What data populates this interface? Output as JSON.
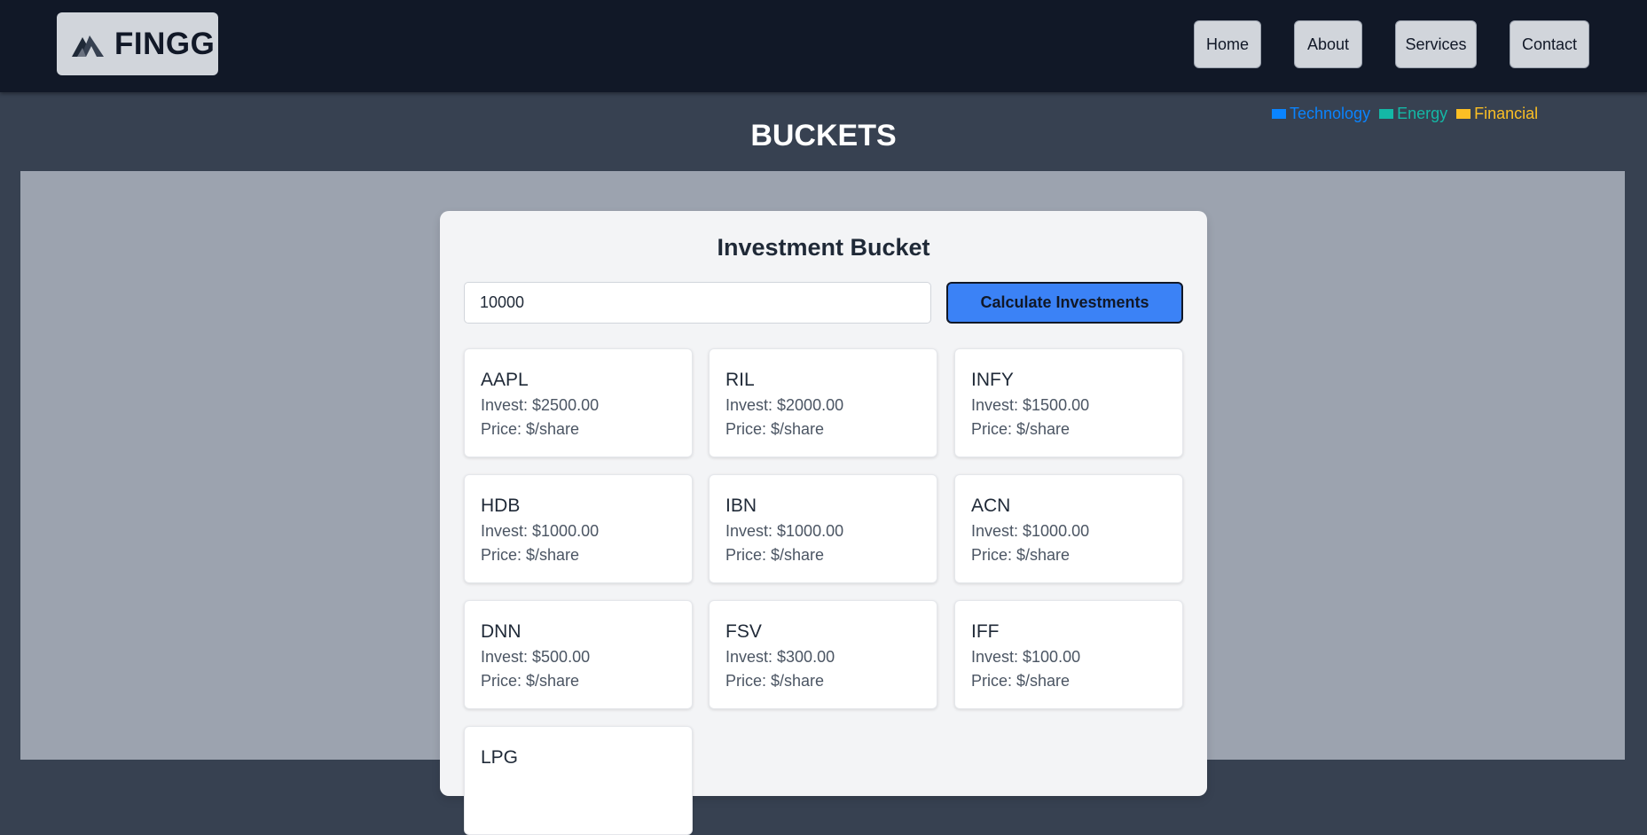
{
  "brand": {
    "name": "FINGG"
  },
  "nav": {
    "items": [
      {
        "label": "Home"
      },
      {
        "label": "About"
      },
      {
        "label": "Services"
      },
      {
        "label": "Contact"
      }
    ]
  },
  "legend": [
    {
      "label": "Technology",
      "color": "#0a84ff"
    },
    {
      "label": "Energy",
      "color": "#14b8a6"
    },
    {
      "label": "Financial",
      "color": "#fbbf24"
    }
  ],
  "page": {
    "title": "BUCKETS"
  },
  "bucket": {
    "title": "Investment Bucket",
    "amount_value": "10000",
    "calculate_label": "Calculate Investments",
    "stocks": [
      {
        "symbol": "AAPL",
        "invest": "Invest: $2500.00",
        "price": "Price: $/share"
      },
      {
        "symbol": "RIL",
        "invest": "Invest: $2000.00",
        "price": "Price: $/share"
      },
      {
        "symbol": "INFY",
        "invest": "Invest: $1500.00",
        "price": "Price: $/share"
      },
      {
        "symbol": "HDB",
        "invest": "Invest: $1000.00",
        "price": "Price: $/share"
      },
      {
        "symbol": "IBN",
        "invest": "Invest: $1000.00",
        "price": "Price: $/share"
      },
      {
        "symbol": "ACN",
        "invest": "Invest: $1000.00",
        "price": "Price: $/share"
      },
      {
        "symbol": "DNN",
        "invest": "Invest: $500.00",
        "price": "Price: $/share"
      },
      {
        "symbol": "FSV",
        "invest": "Invest: $300.00",
        "price": "Price: $/share"
      },
      {
        "symbol": "IFF",
        "invest": "Invest: $100.00",
        "price": "Price: $/share"
      },
      {
        "symbol": "LPG",
        "invest": "",
        "price": ""
      }
    ]
  },
  "colors": {
    "navbar_bg": "#111827",
    "page_bg": "#374151",
    "content_bg": "#9ca3af",
    "accent": "#3b82f6"
  }
}
